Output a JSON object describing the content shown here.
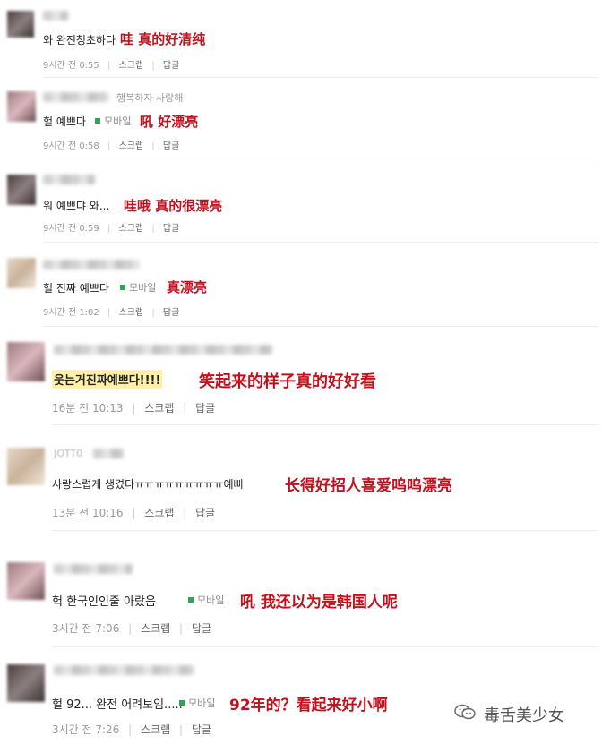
{
  "comments": [
    {
      "name": "",
      "text": "와 완전청초하다",
      "mobile": "",
      "translation": "哇 真的好清纯",
      "time": "9시간 전 0:55",
      "scrap": "스크랩",
      "reply": "답글"
    },
    {
      "name": "행복하자 사랑해",
      "text": "헐 예쁘다",
      "mobile": "모바일",
      "translation": "吼 好漂亮",
      "time": "9시간 전 0:58",
      "scrap": "스크랩",
      "reply": "답글"
    },
    {
      "name": "",
      "text": "워 예쁘댜 와...",
      "mobile": "",
      "translation": "哇哦 真的很漂亮",
      "time": "9시간 전 0:59",
      "scrap": "스크랩",
      "reply": "답글"
    },
    {
      "name": "",
      "text": "헐 진짜 예쁘다",
      "mobile": "모바일",
      "translation": "真漂亮",
      "time": "9시간 전 1:02",
      "scrap": "스크랩",
      "reply": "답글"
    },
    {
      "name": "",
      "text": "웃는거진짜예쁘다!!!!",
      "mobile": "",
      "translation": "笑起来的样子真的好好看",
      "time": "16분 전 10:13",
      "scrap": "스크랩",
      "reply": "답글"
    },
    {
      "name": "JOTT0",
      "text": "사랑스럽게 생겼다ㅠㅠㅠㅠㅠㅠㅠㅠㅠ예뻐",
      "mobile": "",
      "translation": "长得好招人喜爱呜呜漂亮",
      "time": "13분 전 10:16",
      "scrap": "스크랩",
      "reply": "답글"
    },
    {
      "name": "",
      "text": "헉 한국인인줄 아랐음",
      "mobile": "모바일",
      "translation": "吼 我还以为是韩国人呢",
      "time": "3시간 전 7:06",
      "scrap": "스크랩",
      "reply": "답글"
    },
    {
      "name": "",
      "text": "헐 92... 완전 어려보임.....",
      "mobile": "모바일",
      "translation": "92年的？看起来好小啊",
      "time": "3시간 전 7:26",
      "scrap": "스크랩",
      "reply": "답글"
    }
  ],
  "watermark": {
    "icon": "wechat-icon",
    "label": "毒舌美少女"
  },
  "colors": {
    "translation_red": "#c4101c",
    "mobile_green": "#2ca55a",
    "highlight_yellow": "#fff2a8"
  }
}
